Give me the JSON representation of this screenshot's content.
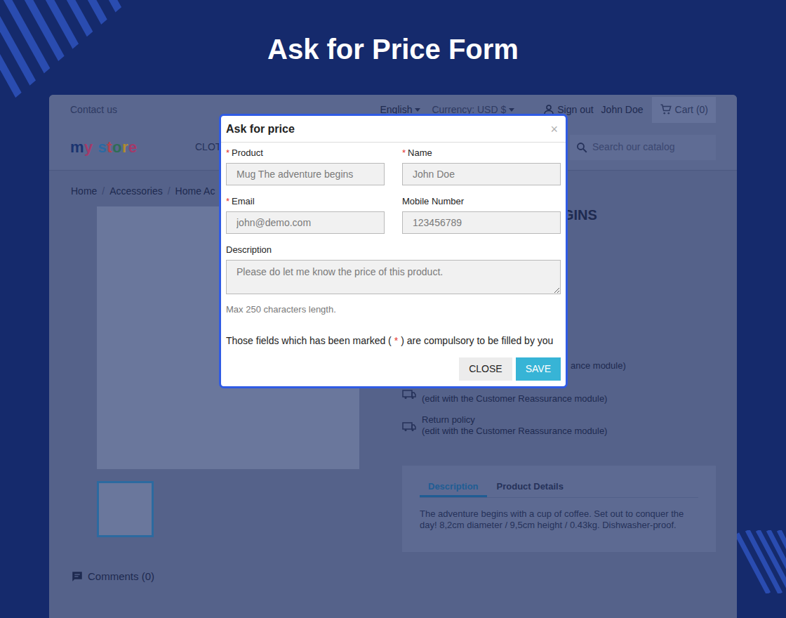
{
  "page_title": "Ask for Price Form",
  "store": {
    "header": {
      "contact": "Contact us",
      "language": "English",
      "currency": "Currency: USD $",
      "sign_out": "Sign out",
      "user": "John Doe",
      "cart": "Cart (0)"
    },
    "logo": "my store",
    "nav": [
      "CLOT"
    ],
    "search": {
      "placeholder": "Search our catalog"
    },
    "breadcrumb": [
      "Home",
      "Accessories",
      "Home Ac"
    ],
    "breadcrumb_separator": "/",
    "thumbnails": [
      {
        "selected": true
      }
    ],
    "product_title": "GINS",
    "reassurance": [
      {
        "kind": "partial",
        "lines": [
          "ance module)"
        ]
      },
      {
        "kind": "full",
        "lines": [
          "(edit with the Customer Reassurance module)"
        ]
      },
      {
        "kind": "full",
        "lines": [
          "Return policy",
          "(edit with the Customer Reassurance module)"
        ]
      }
    ],
    "tabs": [
      {
        "label": "Description",
        "selected": true
      },
      {
        "label": "Product Details",
        "selected": false
      }
    ],
    "description": "The adventure begins with a cup of coffee. Set out to conquer the day! 8,2cm diameter / 9,5cm height / 0.43kg. Dishwasher-proof.",
    "comments": "Comments (0)"
  },
  "modal": {
    "title": "Ask for price",
    "close": "×",
    "required_mark": "*",
    "fields": [
      {
        "kind": "input",
        "label": "Product",
        "required": true,
        "value": "Mug The adventure begins",
        "disabled": true
      },
      {
        "kind": "input",
        "label": "Name",
        "required": true,
        "value": "John Doe",
        "disabled": true
      },
      {
        "kind": "input",
        "label": "Email",
        "required": true,
        "value": "john@demo.com",
        "disabled": true
      },
      {
        "kind": "input",
        "label": "Mobile Number",
        "required": false,
        "value": "123456789",
        "disabled": true
      },
      {
        "kind": "textarea",
        "label": "Description",
        "required": false,
        "value": "Please do let me know the price of this product.",
        "disabled": true
      }
    ],
    "hint": "Max 250 characters length.",
    "note": {
      "before": "Those fields which has been marked (",
      "mark": "*",
      "after": ") are compulsory to be filled by you"
    },
    "buttons": [
      {
        "label": "CLOSE",
        "kind": "secondary"
      },
      {
        "label": "SAVE",
        "kind": "primary"
      }
    ]
  }
}
